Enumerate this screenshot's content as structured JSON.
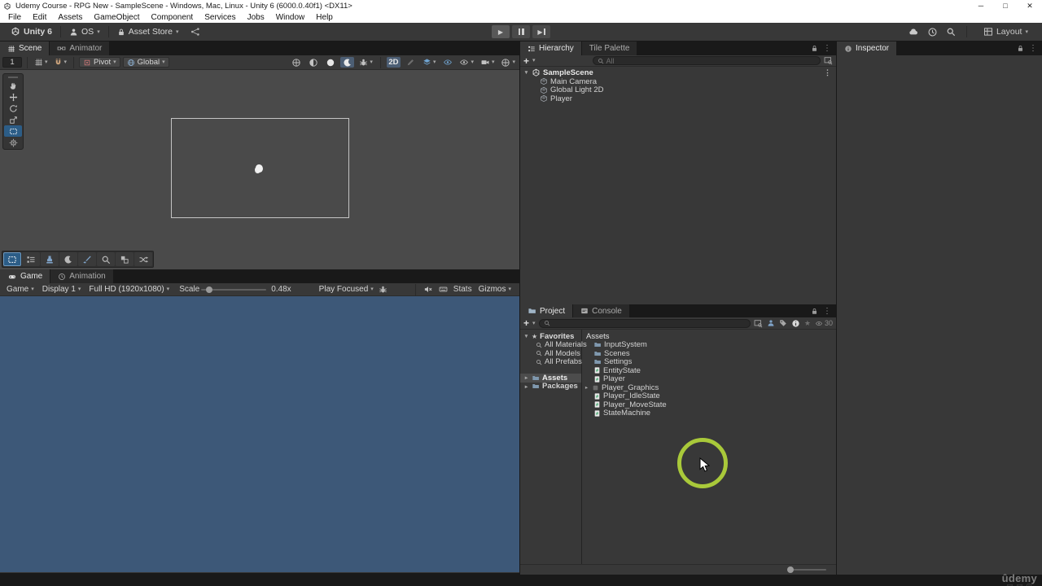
{
  "window": {
    "title": "Udemy Course - RPG New - SampleScene - Windows, Mac, Linux - Unity 6 (6000.0.40f1) <DX11>",
    "minimize": "─",
    "maximize": "□",
    "close": "✕"
  },
  "menubar": [
    "File",
    "Edit",
    "Assets",
    "GameObject",
    "Component",
    "Services",
    "Jobs",
    "Window",
    "Help"
  ],
  "toolbar": {
    "unity_version": "Unity 6",
    "os_label": "OS",
    "asset_store_label": "Asset Store",
    "layout_label": "Layout"
  },
  "scene": {
    "tab_scene": "Scene",
    "tab_animator": "Animator",
    "grid_size": "1",
    "pivot_label": "Pivot",
    "global_label": "Global",
    "mode_2d": "2D"
  },
  "game": {
    "tab_game": "Game",
    "tab_animation": "Animation",
    "view_label": "Game",
    "display_label": "Display 1",
    "resolution_label": "Full HD (1920x1080)",
    "scale_label": "Scale",
    "scale_value": "0.48x",
    "focus_label": "Play Focused",
    "stats_label": "Stats",
    "gizmos_label": "Gizmos"
  },
  "hierarchy": {
    "tab_hierarchy": "Hierarchy",
    "tab_tile_palette": "Tile Palette",
    "search_placeholder": "All",
    "scene_name": "SampleScene",
    "objects": [
      "Main Camera",
      "Global Light 2D",
      "Player"
    ]
  },
  "inspector": {
    "tab": "Inspector"
  },
  "project": {
    "tab_project": "Project",
    "tab_console": "Console",
    "favorites_label": "Favorites",
    "favorites": [
      "All Materials",
      "All Models",
      "All Prefabs"
    ],
    "root_assets": "Assets",
    "root_packages": "Packages",
    "list_header": "Assets",
    "items": [
      {
        "name": "InputSystem",
        "type": "folder"
      },
      {
        "name": "Scenes",
        "type": "folder"
      },
      {
        "name": "Settings",
        "type": "folder"
      },
      {
        "name": "EntityState",
        "type": "script"
      },
      {
        "name": "Player",
        "type": "script"
      },
      {
        "name": "Player_Graphics",
        "type": "prefab"
      },
      {
        "name": "Player_IdleState",
        "type": "script"
      },
      {
        "name": "Player_MoveState",
        "type": "script"
      },
      {
        "name": "StateMachine",
        "type": "script"
      }
    ],
    "hidden_count": "30"
  },
  "watermark": "ûdemy",
  "glyphs": {
    "chevron_down": "▾",
    "foldout_open": "▼",
    "foldout_closed": "▸",
    "kebab": "⋮",
    "star": "★",
    "play": "▶",
    "plus": "+",
    "grip": "≡"
  },
  "colors": {
    "selection_blue": "#2c5d87",
    "toggle_blue": "#4c5e74",
    "highlight_ring_green": "#a9c93a",
    "game_view_blue": "#3d5878",
    "script_icon_green": "#2f9e5f",
    "folder_icon_blue": "#7f98ae",
    "panel_bg": "#383838",
    "chrome_white": "#ffffff"
  }
}
